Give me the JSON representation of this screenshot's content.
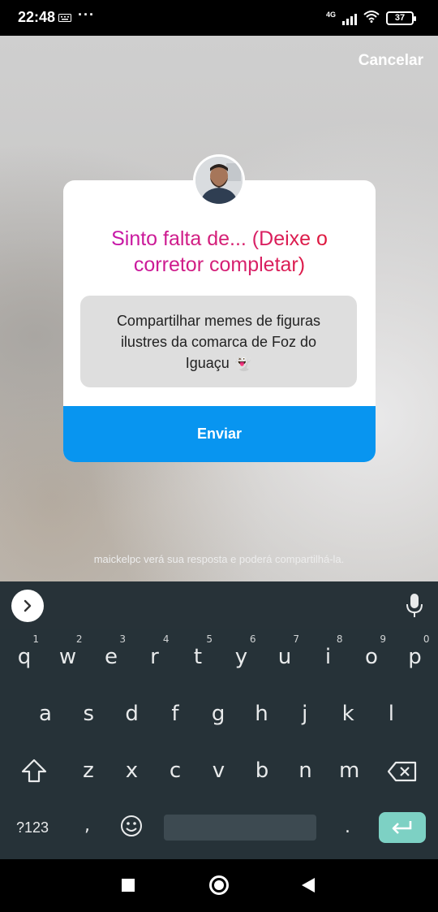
{
  "status_bar": {
    "time": "22:48",
    "network": "4G",
    "battery": "37"
  },
  "header": {
    "cancel_label": "Cancelar"
  },
  "card": {
    "question": "Sinto falta de... (Deixe o corretor completar)",
    "answer": "Compartilhar memes de figuras ilustres da comarca de Foz do Iguaçu 👻",
    "send_label": "Enviar"
  },
  "notice": "maickelpc verá sua resposta e poderá compartilhá-la.",
  "keyboard": {
    "row1": [
      {
        "k": "q",
        "h": "1"
      },
      {
        "k": "w",
        "h": "2"
      },
      {
        "k": "e",
        "h": "3"
      },
      {
        "k": "r",
        "h": "4"
      },
      {
        "k": "t",
        "h": "5"
      },
      {
        "k": "y",
        "h": "6"
      },
      {
        "k": "u",
        "h": "7"
      },
      {
        "k": "i",
        "h": "8"
      },
      {
        "k": "o",
        "h": "9"
      },
      {
        "k": "p",
        "h": "0"
      }
    ],
    "row2": [
      "a",
      "s",
      "d",
      "f",
      "g",
      "h",
      "j",
      "k",
      "l"
    ],
    "row3": [
      "z",
      "x",
      "c",
      "v",
      "b",
      "n",
      "m"
    ],
    "symbols_label": "?123",
    "comma": ",",
    "period": "."
  },
  "colors": {
    "send_button": "#0895f0",
    "keyboard_bg": "#263238",
    "enter_key": "#7dd1c4"
  }
}
